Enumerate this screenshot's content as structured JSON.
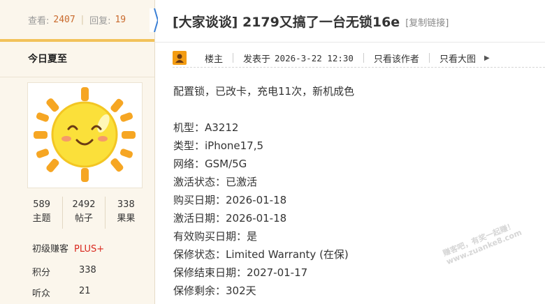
{
  "sidebar": {
    "views_label": "查看:",
    "views_value": "2407",
    "replies_label": "回复:",
    "replies_value": "19",
    "username": "今日夏至",
    "counts": [
      {
        "value": "589",
        "label": "主题"
      },
      {
        "value": "2492",
        "label": "帖子"
      },
      {
        "value": "338",
        "label": "果果"
      }
    ],
    "level": "初级赚客",
    "level_plus": "PLUS+",
    "info": [
      {
        "label": "积分",
        "value": "338"
      },
      {
        "label": "听众",
        "value": "21"
      }
    ]
  },
  "thread": {
    "title": "[大家谈谈] 2179又搞了一台无锁16e",
    "copy_link": "[复制链接]"
  },
  "post_meta": {
    "owner": "楼主",
    "posted_label": "发表于",
    "posted_date": "2026-3-22 12:30",
    "only_author": "只看该作者",
    "only_images": "只看大图"
  },
  "content": {
    "intro": "配置锁，已改卡，充电11次，新机成色",
    "lines": [
      "机型：A3212",
      "类型：iPhone17,5",
      "网络：GSM/5G",
      "激活状态：已激活",
      "购买日期：2026-01-18",
      "激活日期：2026-01-18",
      "有效购买日期：是",
      "保修状态：Limited Warranty (在保)",
      "保修结束日期：2027-01-17",
      "保修剩余：302天"
    ]
  },
  "watermark": {
    "line1": "赚客吧，有奖一起赚！",
    "line2": "www.zuanke8.com"
  },
  "colors": {
    "sidebar_bg": "#fbf6ec",
    "accent_bar": "#f2c25a",
    "number_orange": "#c96a2d",
    "plus_red": "#d9281e"
  }
}
